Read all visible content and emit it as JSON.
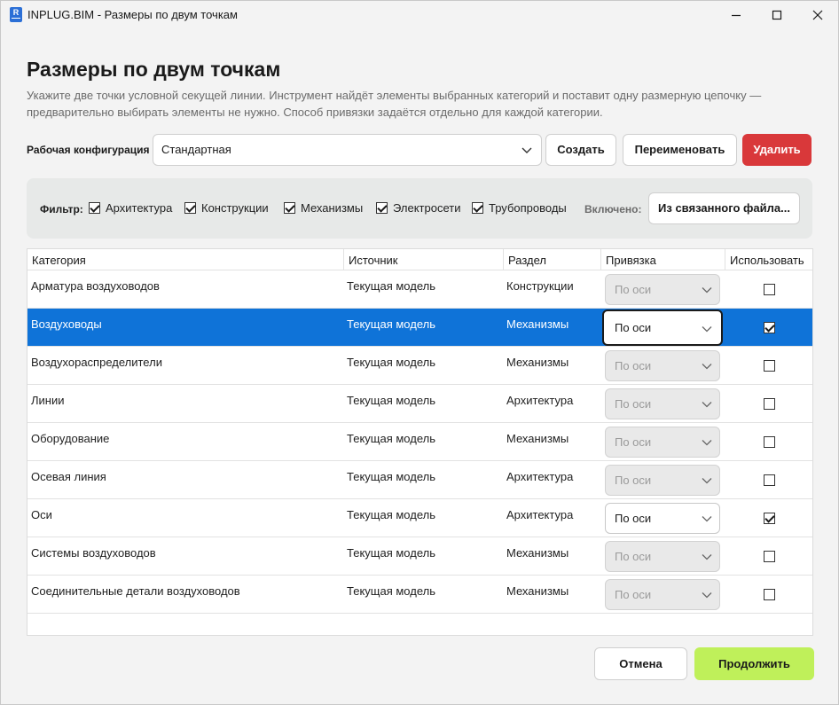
{
  "window": {
    "app_icon_text": "R",
    "title": "INPLUG.BIM - Размеры по двум точкам"
  },
  "header": {
    "title": "Размеры по двум точкам",
    "description": "Укажите две точки условной секущей линии. Инструмент найдёт элементы выбранных категорий и поставит одну размерную цепочку — предварительно выбирать элементы не нужно. Способ привязки задаётся отдельно для каждой категории."
  },
  "config": {
    "label": "Рабочая конфигурация",
    "selected": "Стандартная",
    "create_label": "Создать",
    "rename_label": "Переименовать",
    "delete_label": "Удалить"
  },
  "filter": {
    "label": "Фильтр:",
    "items": [
      {
        "label": "Архитектура",
        "checked": true
      },
      {
        "label": "Конструкции",
        "checked": true
      },
      {
        "label": "Механизмы",
        "checked": true
      },
      {
        "label": "Электросети",
        "checked": true
      },
      {
        "label": "Трубопроводы",
        "checked": true
      }
    ],
    "included_label": "Включено:",
    "linked_button_label": "Из связанного файла..."
  },
  "table": {
    "columns": [
      "Категория",
      "Источник",
      "Раздел",
      "Привязка",
      "Использовать"
    ],
    "rows": [
      {
        "category": "Арматура воздуховодов",
        "source": "Текущая модель",
        "section": "Конструкции",
        "snap": "По оси",
        "use": false,
        "selected": false
      },
      {
        "category": "Воздуховоды",
        "source": "Текущая модель",
        "section": "Механизмы",
        "snap": "По оси",
        "use": true,
        "selected": true
      },
      {
        "category": "Воздухораспределители",
        "source": "Текущая модель",
        "section": "Механизмы",
        "snap": "По оси",
        "use": false,
        "selected": false
      },
      {
        "category": "Линии",
        "source": "Текущая модель",
        "section": "Архитектура",
        "snap": "По оси",
        "use": false,
        "selected": false
      },
      {
        "category": "Оборудование",
        "source": "Текущая модель",
        "section": "Механизмы",
        "snap": "По оси",
        "use": false,
        "selected": false
      },
      {
        "category": "Осевая линия",
        "source": "Текущая модель",
        "section": "Архитектура",
        "snap": "По оси",
        "use": false,
        "selected": false
      },
      {
        "category": "Оси",
        "source": "Текущая модель",
        "section": "Архитектура",
        "snap": "По оси",
        "use": true,
        "selected": false
      },
      {
        "category": "Системы воздуховодов",
        "source": "Текущая модель",
        "section": "Механизмы",
        "snap": "По оси",
        "use": false,
        "selected": false
      },
      {
        "category": "Соединительные детали воздуховодов",
        "source": "Текущая модель",
        "section": "Механизмы",
        "snap": "По оси",
        "use": false,
        "selected": false
      }
    ]
  },
  "footer": {
    "cancel_label": "Отмена",
    "continue_label": "Продолжить"
  },
  "colors": {
    "accent": "#0f73d8",
    "delete": "#d9383a",
    "continue": "#bff05a"
  }
}
